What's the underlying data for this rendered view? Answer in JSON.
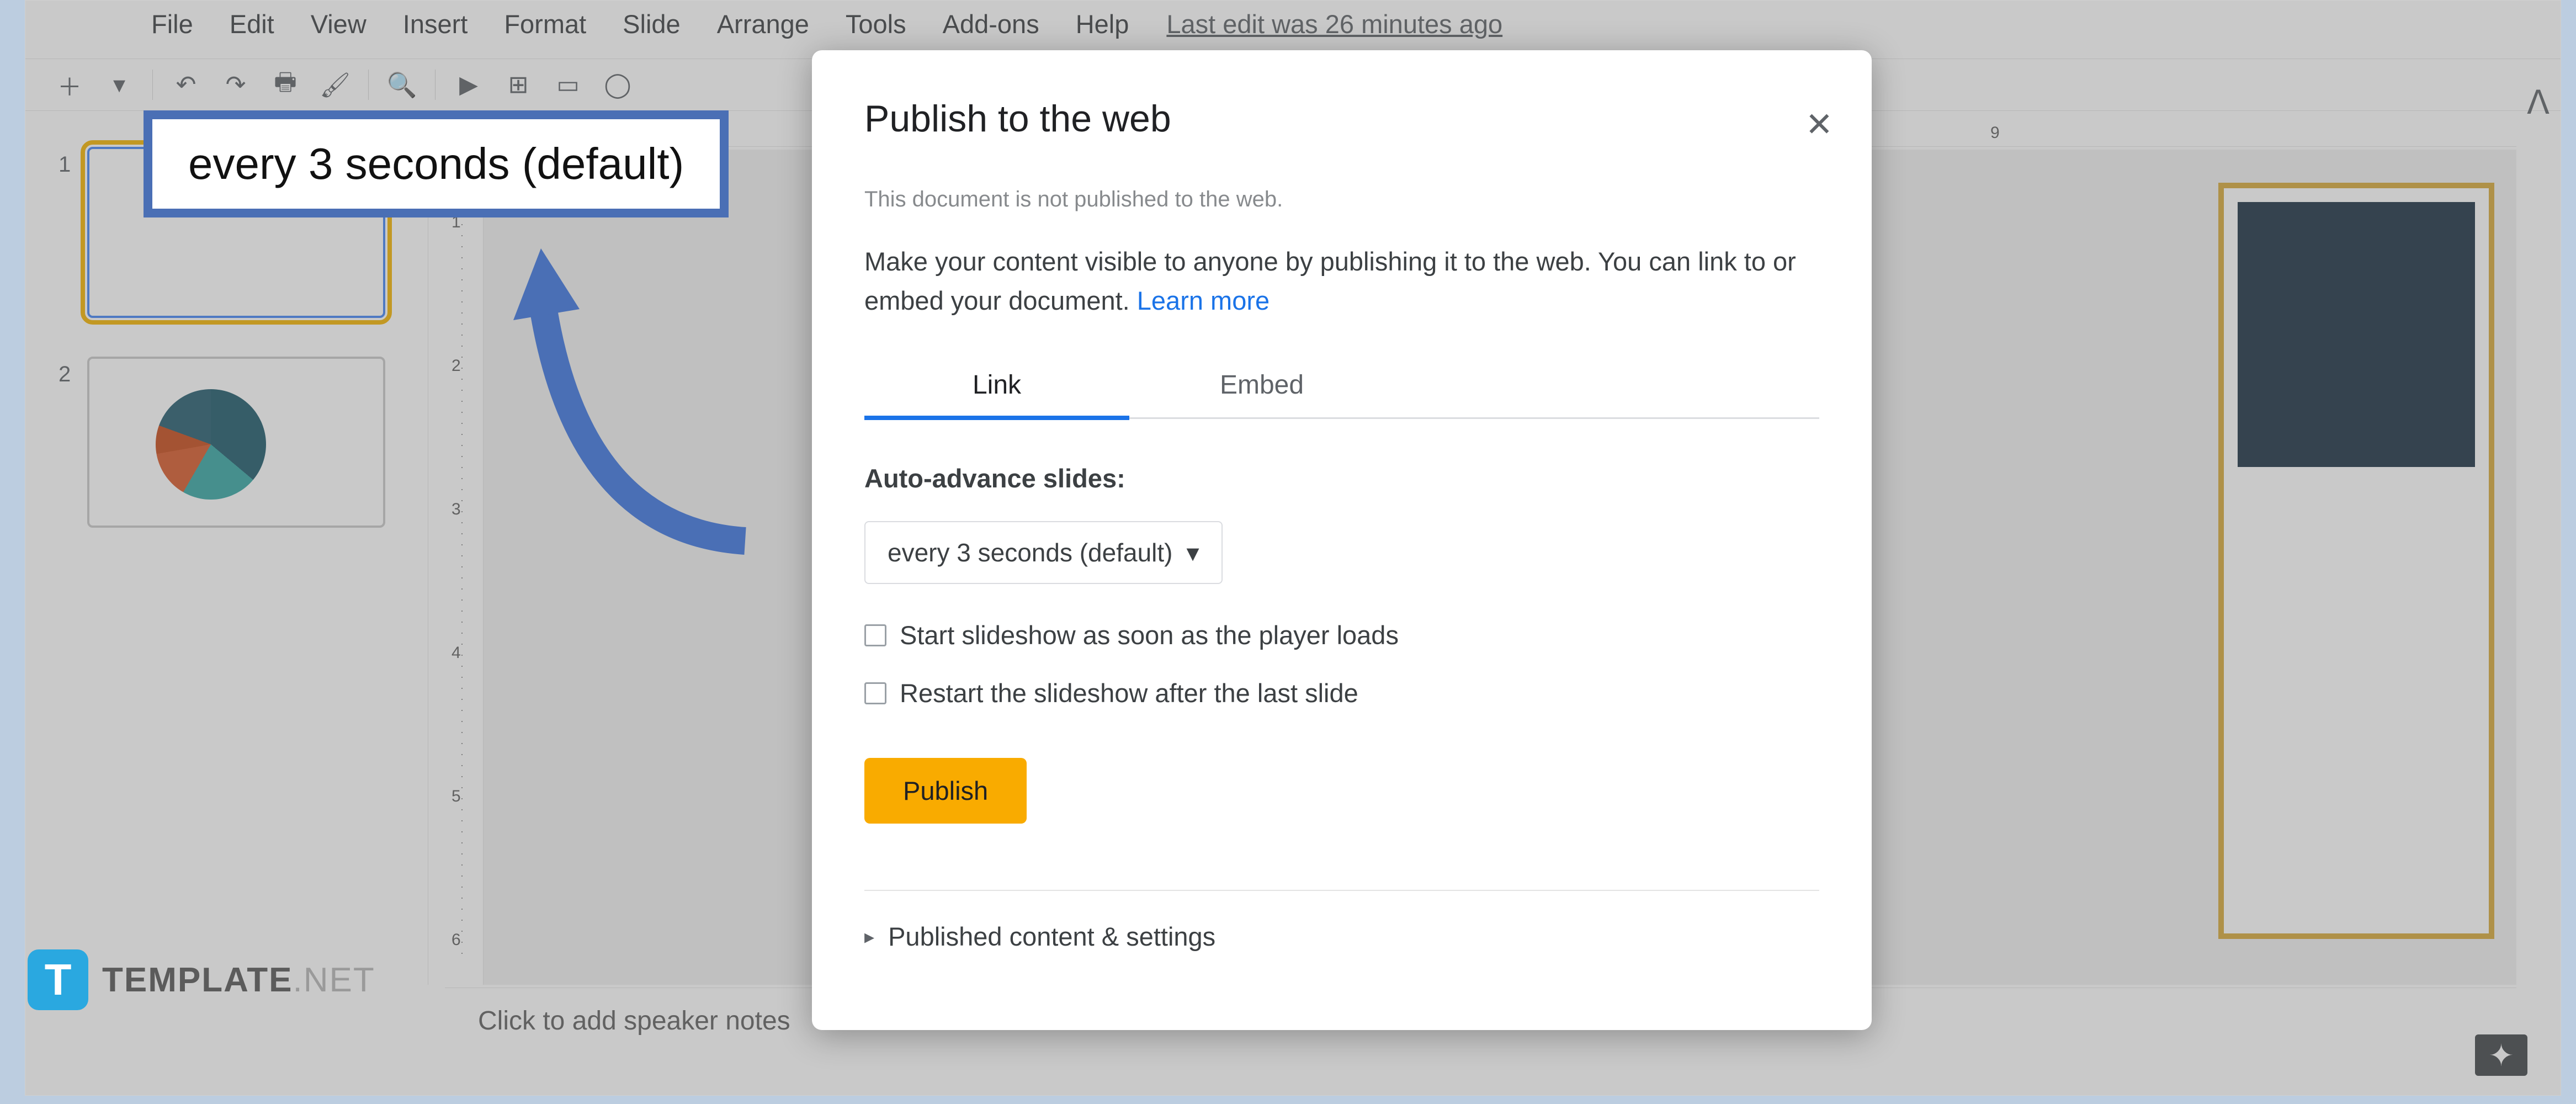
{
  "menu": [
    "File",
    "Edit",
    "View",
    "Insert",
    "Format",
    "Slide",
    "Arrange",
    "Tools",
    "Add-ons",
    "Help"
  ],
  "last_edit": "Last edit was 26 minutes ago",
  "thumbs": [
    {
      "num": "1"
    },
    {
      "num": "2"
    }
  ],
  "vruler": [
    "1",
    "2",
    "3",
    "4",
    "5",
    "6"
  ],
  "hruler": [
    "9"
  ],
  "notes_placeholder": "Click to add speaker notes",
  "dialog": {
    "title": "Publish to the web",
    "not_published": "This document is not published to the web.",
    "description": "Make your content visible to anyone by publishing it to the web. You can link to or embed your document. ",
    "learn_more": "Learn more",
    "tabs": [
      "Link",
      "Embed"
    ],
    "auto_advance_label": "Auto-advance slides:",
    "auto_advance_value": "every 3 seconds (default)",
    "chk1": "Start slideshow as soon as the player loads",
    "chk2": "Restart the slideshow after the last slide",
    "publish_btn": "Publish",
    "expand_label": "Published content & settings"
  },
  "annotation": {
    "text": "every 3 seconds (default)"
  },
  "watermark": {
    "icon_letter": "T",
    "brand": "TEMPLATE",
    "suffix": ".NET"
  }
}
